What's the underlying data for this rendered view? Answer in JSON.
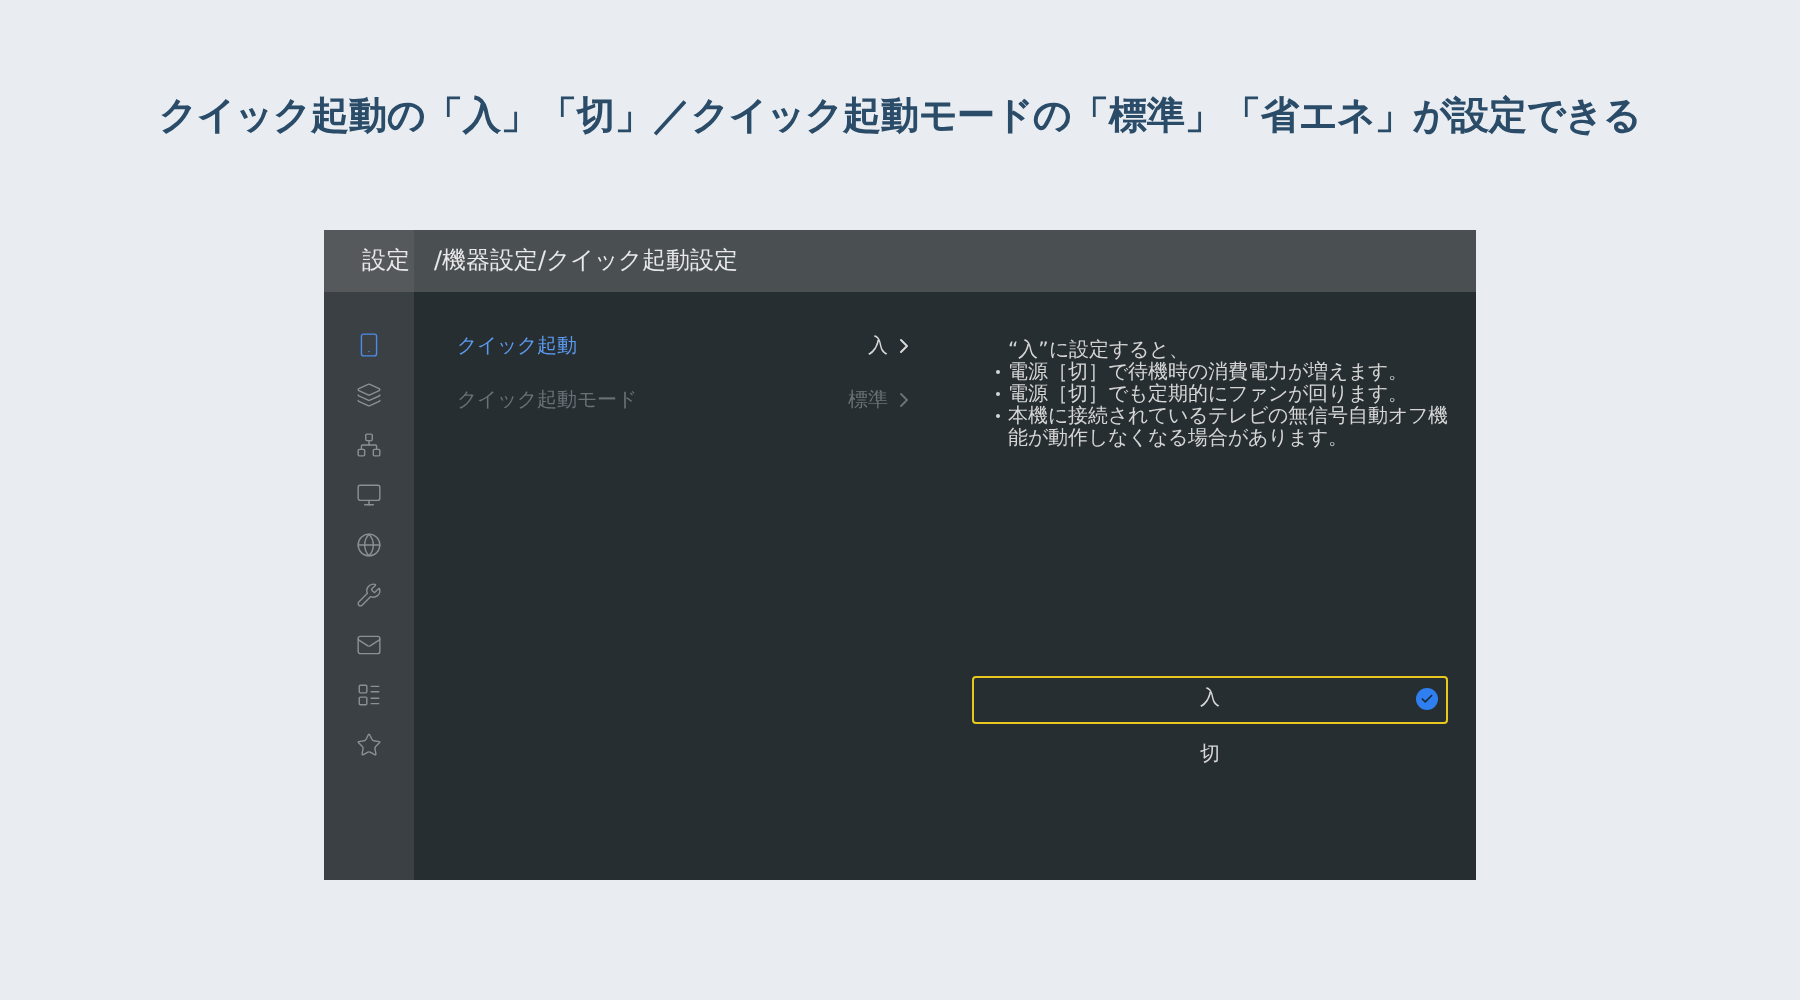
{
  "headline": "クイック起動の「入」「切」／クイック起動モードの「標準」「省エネ」が設定できる",
  "title_bar": {
    "section": "設定",
    "path": "/機器設定/クイック起動設定"
  },
  "sidebar": {
    "items": [
      {
        "selected": true
      },
      {
        "selected": false
      },
      {
        "selected": false
      },
      {
        "selected": false
      },
      {
        "selected": false
      },
      {
        "selected": false
      },
      {
        "selected": false
      },
      {
        "selected": false
      },
      {
        "selected": false
      }
    ]
  },
  "menu": [
    {
      "label": "クイック起動",
      "value": "入",
      "selected": true
    },
    {
      "label": "クイック起動モード",
      "value": "標準",
      "selected": false
    }
  ],
  "description": {
    "intro": "“入”に設定すると、",
    "bullets": [
      "電源［切］で待機時の消費電力が増えます。",
      "電源［切］でも定期的にファンが回ります。",
      "本機に接続されているテレビの無信号自動オフ機能が動作しなくなる場合があります。"
    ]
  },
  "options": [
    {
      "label": "入",
      "selected": true
    },
    {
      "label": "切",
      "selected": false
    }
  ]
}
